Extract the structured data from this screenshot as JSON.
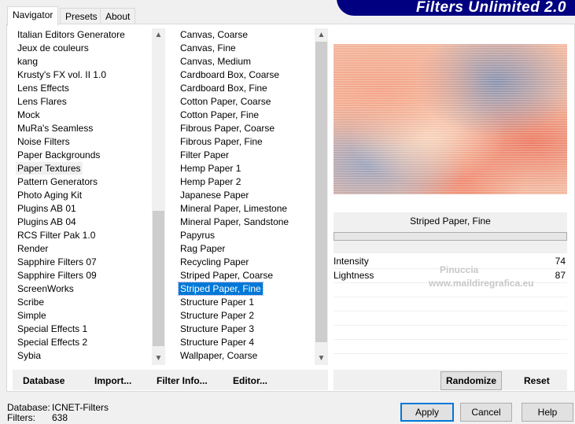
{
  "app": {
    "title": "Filters Unlimited 2.0"
  },
  "tabs": [
    {
      "label": "Navigator"
    },
    {
      "label": "Presets"
    },
    {
      "label": "About"
    }
  ],
  "categories": [
    "Italian Editors Generatore",
    "Jeux de couleurs",
    "kang",
    "Krusty's FX vol. II 1.0",
    "Lens Effects",
    "Lens Flares",
    "Mock",
    "MuRa's Seamless",
    "Noise Filters",
    "Paper Backgrounds",
    "Paper Textures",
    "Pattern Generators",
    "Photo Aging Kit",
    "Plugins AB 01",
    "Plugins AB 04",
    "RCS Filter Pak 1.0",
    "Render",
    "Sapphire Filters 07",
    "Sapphire Filters 09",
    "ScreenWorks",
    "Scribe",
    "Simple",
    "Special Effects 1",
    "Special Effects 2",
    "Sybia"
  ],
  "selected_category": "Paper Textures",
  "filters": [
    "Canvas, Coarse",
    "Canvas, Fine",
    "Canvas, Medium",
    "Cardboard Box, Coarse",
    "Cardboard Box, Fine",
    "Cotton Paper, Coarse",
    "Cotton Paper, Fine",
    "Fibrous Paper, Coarse",
    "Fibrous Paper, Fine",
    "Filter Paper",
    "Hemp Paper 1",
    "Hemp Paper 2",
    "Japanese Paper",
    "Mineral Paper, Limestone",
    "Mineral Paper, Sandstone",
    "Papyrus",
    "Rag Paper",
    "Recycling Paper",
    "Striped Paper, Coarse",
    "Striped Paper, Fine",
    "Structure Paper 1",
    "Structure Paper 2",
    "Structure Paper 3",
    "Structure Paper 4",
    "Wallpaper, Coarse"
  ],
  "selected_filter": "Striped Paper, Fine",
  "preview": {
    "filter_name": "Striped Paper, Fine",
    "watermark": [
      "Pinuccia",
      "www.maildiregrafica.eu"
    ]
  },
  "params": [
    {
      "label": "Intensity",
      "value": "74"
    },
    {
      "label": "Lightness",
      "value": "87"
    }
  ],
  "buttons": {
    "database": "Database",
    "import": "Import...",
    "filter_info": "Filter Info...",
    "editor": "Editor...",
    "randomize": "Randomize",
    "reset": "Reset",
    "apply": "Apply",
    "cancel": "Cancel",
    "help": "Help"
  },
  "status": {
    "database_label": "Database:",
    "database_value": "ICNET-Filters",
    "filters_label": "Filters:",
    "filters_value": "638"
  },
  "colors": {
    "banner": "#000080",
    "selection": "#0078d7"
  }
}
